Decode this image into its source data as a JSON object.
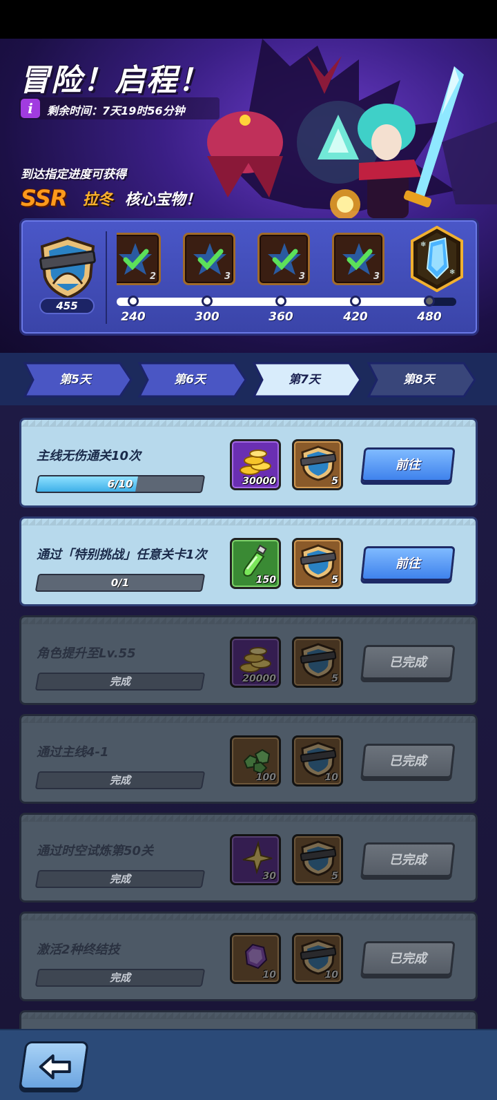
{
  "header": {
    "title": "冒险！启程！",
    "timer_icon": "info-icon",
    "timer_text": "剩余时间：7天19时56分钟",
    "reach_text": "到达指定进度可获得",
    "ssr": "SSR",
    "hero_name": "拉冬",
    "core_text": "核心宝物！"
  },
  "progress": {
    "current_score": "455",
    "tiers": [
      {
        "count": "2",
        "claimed": true
      },
      {
        "count": "3",
        "claimed": true
      },
      {
        "count": "3",
        "claimed": true
      },
      {
        "count": "3",
        "claimed": true
      }
    ],
    "milestones": [
      "240",
      "300",
      "360",
      "420",
      "480"
    ]
  },
  "tabs": [
    {
      "label": "第5天",
      "active": false
    },
    {
      "label": "第6天",
      "active": false
    },
    {
      "label": "第7天",
      "active": true
    },
    {
      "label": "第8天",
      "active": false
    }
  ],
  "tasks": [
    {
      "label": "主线无伤通关10次",
      "progress_text": "6/10",
      "progress": 0.6,
      "reward1": {
        "icon": "gold-coins-icon",
        "value": "30000"
      },
      "reward2": {
        "icon": "badge-shield-icon",
        "value": "5"
      },
      "button": "前往",
      "done": false
    },
    {
      "label": "通过「特别挑战」任意关卡1次",
      "progress_text": "0/1",
      "progress": 0,
      "reward1": {
        "icon": "potion-icon",
        "value": "150"
      },
      "reward2": {
        "icon": "badge-shield-icon",
        "value": "5"
      },
      "button": "前往",
      "done": false
    },
    {
      "label": "角色提升至Lv.55",
      "progress_text": "完成",
      "progress": 1,
      "reward1": {
        "icon": "gold-coins-icon",
        "value": "20000"
      },
      "reward2": {
        "icon": "badge-shield-icon",
        "value": "5"
      },
      "button": "已完成",
      "done": true
    },
    {
      "label": "通过主线4-1",
      "progress_text": "完成",
      "progress": 1,
      "reward1": {
        "icon": "green-gems-icon",
        "value": "100"
      },
      "reward2": {
        "icon": "badge-shield-icon",
        "value": "10"
      },
      "button": "已完成",
      "done": true
    },
    {
      "label": "通过时空试炼第50关",
      "progress_text": "完成",
      "progress": 1,
      "reward1": {
        "icon": "star-shard-icon",
        "value": "30"
      },
      "reward2": {
        "icon": "badge-shield-icon",
        "value": "5"
      },
      "button": "已完成",
      "done": true
    },
    {
      "label": "激活2种终结技",
      "progress_text": "完成",
      "progress": 1,
      "reward1": {
        "icon": "purple-crystal-icon",
        "value": "10"
      },
      "reward2": {
        "icon": "badge-shield-icon",
        "value": "10"
      },
      "button": "已完成",
      "done": true
    }
  ],
  "bottom": {
    "back_icon": "back-arrow-icon"
  }
}
